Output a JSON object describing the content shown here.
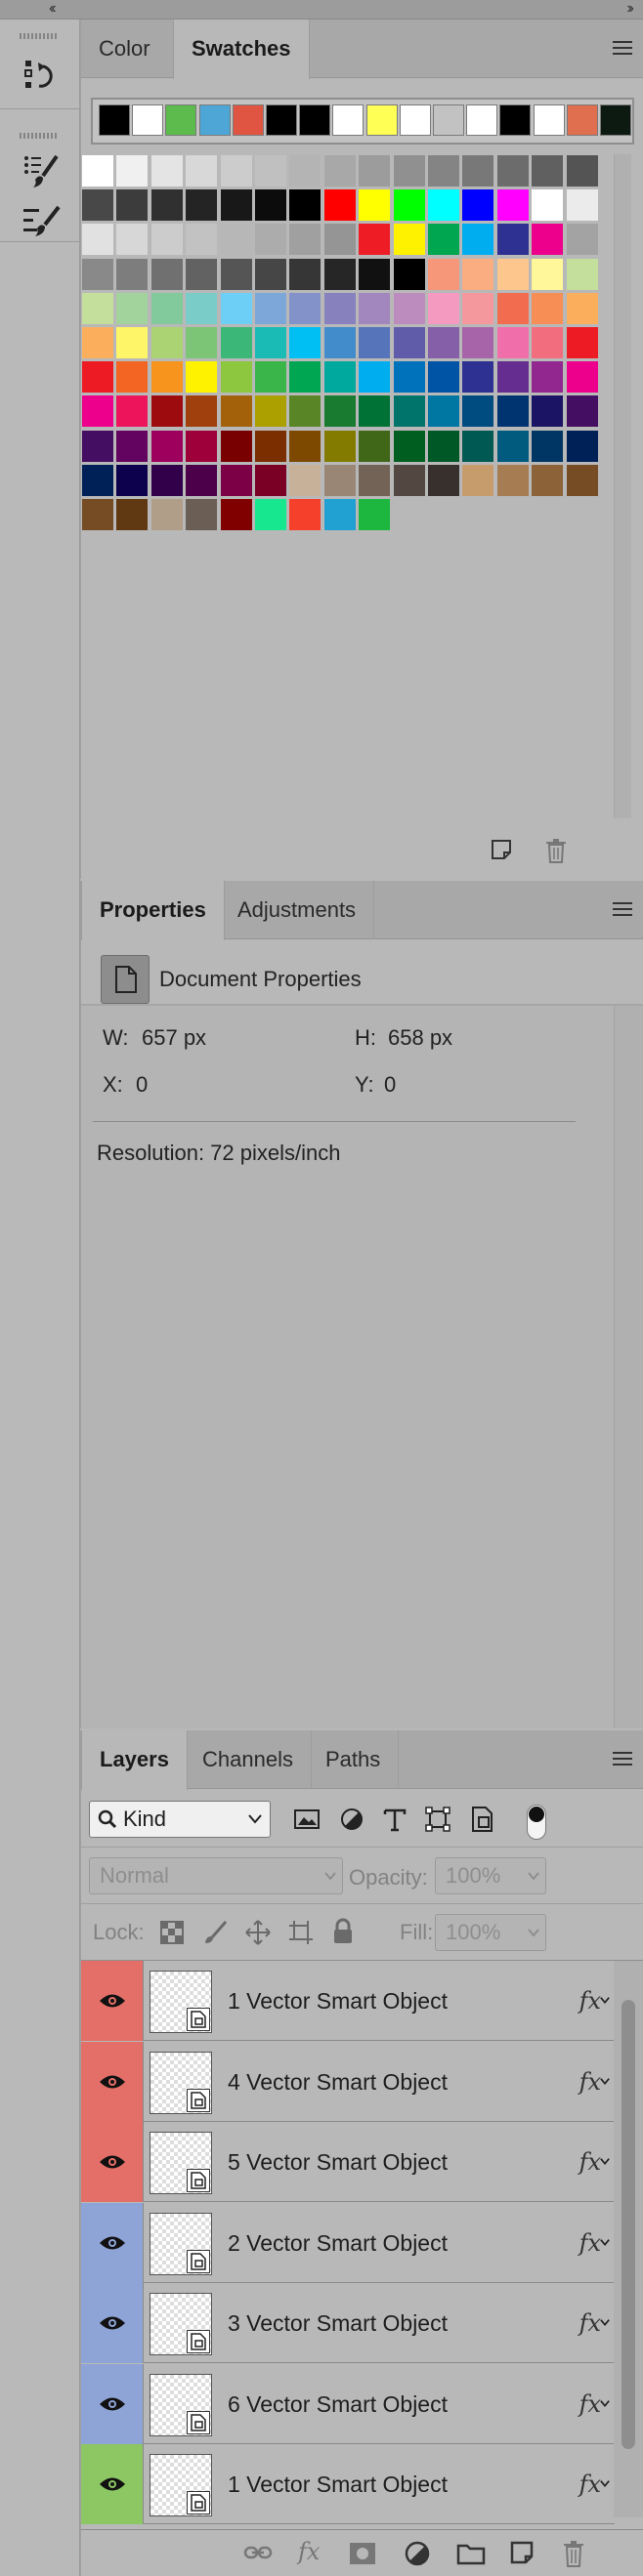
{
  "colors": {
    "eye_red": "#e46f68",
    "eye_blue": "#8ea3d6",
    "eye_green": "#8cc763"
  },
  "swatches_panel": {
    "tabs": [
      {
        "label": "Color",
        "active": false
      },
      {
        "label": "Swatches",
        "active": true
      }
    ],
    "recent": [
      "#000000",
      "#ffffff",
      "#5cbb4c",
      "#4ea6d6",
      "#e05541",
      "#000000",
      "#000000",
      "#ffffff",
      "#ffff55",
      "#ffffff",
      "#c2c2c2",
      "#ffffff",
      "#000000",
      "#ffffff",
      "#e06f4f",
      "#0d1a12"
    ],
    "grid_rows": [
      [
        "#ffffff",
        "#f0f0f0",
        "#e4e4e4",
        "#d8d8d8",
        "#cccccc",
        "#c0c0c0",
        "#b4b4b4",
        "#a8a8a8",
        "#9c9c9c",
        "#909090",
        "#848484",
        "#787878",
        "#6c6c6c",
        "#606060",
        "#545454"
      ],
      [
        "#484848",
        "#3c3c3c",
        "#303030",
        "#242424",
        "#181818",
        "#0c0c0c",
        "#000000",
        "#ff0000",
        "#ffff00",
        "#00ff00",
        "#00ffff",
        "#0000ff",
        "#ff00ff",
        "#ffffff",
        "#ebebeb"
      ],
      [
        "#e1e1e1",
        "#d7d7d7",
        "#cccccc",
        "#c2c2c2",
        "#b7b7b7",
        "#acacac",
        "#a0a0a0",
        "#959595",
        "#ee1c24",
        "#fff200",
        "#00a650",
        "#00aeef",
        "#2e3192",
        "#ec008c",
        "#a3a3a3"
      ],
      [
        "#898989",
        "#7d7d7d",
        "#707070",
        "#626262",
        "#555555",
        "#464646",
        "#363636",
        "#262626",
        "#111111",
        "#000000",
        "#f7977a",
        "#fbad82",
        "#fdc68c",
        "#fff799",
        "#c3df9b"
      ],
      [
        "#c4df9b",
        "#a3d39c",
        "#82ca9c",
        "#7accc8",
        "#6dcff6",
        "#7da7d9",
        "#8393ca",
        "#8781bd",
        "#a187be",
        "#bd8cbf",
        "#f49ac1",
        "#f5989d",
        "#f26c4f",
        "#f68e56",
        "#fbaf5c"
      ],
      [
        "#fbaf5d",
        "#fff568",
        "#acd373",
        "#7cc576",
        "#3bb878",
        "#1abbb4",
        "#00bff3",
        "#438ccb",
        "#5574b9",
        "#605ca9",
        "#8560a8",
        "#a864a8",
        "#f06ea9",
        "#f26d7d",
        "#ed1c24"
      ],
      [
        "#ed1c24",
        "#f26522",
        "#f7941d",
        "#fff200",
        "#8dc63f",
        "#39b54a",
        "#00a651",
        "#00a99d",
        "#00aeef",
        "#0072bc",
        "#0054a6",
        "#2e3192",
        "#662d91",
        "#92278f",
        "#ec008c"
      ],
      [
        "#ec008c",
        "#ed145b",
        "#9e0b0f",
        "#a0410d",
        "#a3620a",
        "#aba000",
        "#598527",
        "#197b30",
        "#007236",
        "#00746b",
        "#0076a3",
        "#004b80",
        "#003471",
        "#1b1464",
        "#440e62"
      ],
      [
        "#440e62",
        "#630460",
        "#9e005d",
        "#9e0039",
        "#790000",
        "#7b2e00",
        "#7d4900",
        "#827b00",
        "#406618",
        "#005e20",
        "#005826",
        "#005952",
        "#005b7f",
        "#003663",
        "#002157"
      ],
      [
        "#002157",
        "#0d004c",
        "#32004b",
        "#4b0049",
        "#7b0046",
        "#7a0026",
        "#c7b299",
        "#998675",
        "#736357",
        "#534741",
        "#37302d",
        "#c69c6d",
        "#a67c52",
        "#8c6239",
        "#754c24"
      ],
      [
        "#754c24",
        "#603913",
        "#b09e89",
        "#6b5f55",
        "#800000",
        "#17e88f",
        "#f5402c",
        "#21a0d2",
        "#1db63f"
      ]
    ],
    "new_swatch_icon": "new-swatch-icon",
    "delete_icon": "trash-icon"
  },
  "properties_panel": {
    "tabs": [
      {
        "label": "Properties",
        "active": true
      },
      {
        "label": "Adjustments",
        "active": false
      }
    ],
    "header_title": "Document Properties",
    "w_label": "W:",
    "w_value": "657 px",
    "h_label": "H:",
    "h_value": "658 px",
    "x_label": "X:",
    "x_value": "0",
    "y_label": "Y:",
    "y_value": "0",
    "resolution": "Resolution: 72 pixels/inch"
  },
  "layers_panel": {
    "tabs": [
      {
        "label": "Layers",
        "active": true
      },
      {
        "label": "Channels",
        "active": false
      },
      {
        "label": "Paths",
        "active": false
      }
    ],
    "filter_kind": "Kind",
    "blend_mode": "Normal",
    "opacity_label": "Opacity:",
    "opacity_value": "100%",
    "lock_label": "Lock:",
    "fill_label": "Fill:",
    "fill_value": "100%",
    "layers": [
      {
        "name": "1 Vector Smart Object",
        "eye_color": "#e46f68",
        "fx": "fx"
      },
      {
        "name": "4 Vector Smart Object",
        "eye_color": "#e46f68",
        "fx": "fx"
      },
      {
        "name": "5 Vector Smart Object",
        "eye_color": "#e46f68",
        "fx": "fx"
      },
      {
        "name": "2 Vector Smart Object",
        "eye_color": "#8ea3d6",
        "fx": "fx"
      },
      {
        "name": "3 Vector Smart Object",
        "eye_color": "#8ea3d6",
        "fx": "fx"
      },
      {
        "name": "6 Vector Smart Object",
        "eye_color": "#8ea3d6",
        "fx": "fx"
      },
      {
        "name": "1 Vector Smart Object",
        "eye_color": "#8cc763",
        "fx": "fx"
      }
    ],
    "footer_icons": [
      "link-layers-icon",
      "fx-icon",
      "mask-icon",
      "adjustment-layer-icon",
      "group-folder-icon",
      "new-layer-icon",
      "trash-icon"
    ],
    "footer_fx": "fx"
  }
}
